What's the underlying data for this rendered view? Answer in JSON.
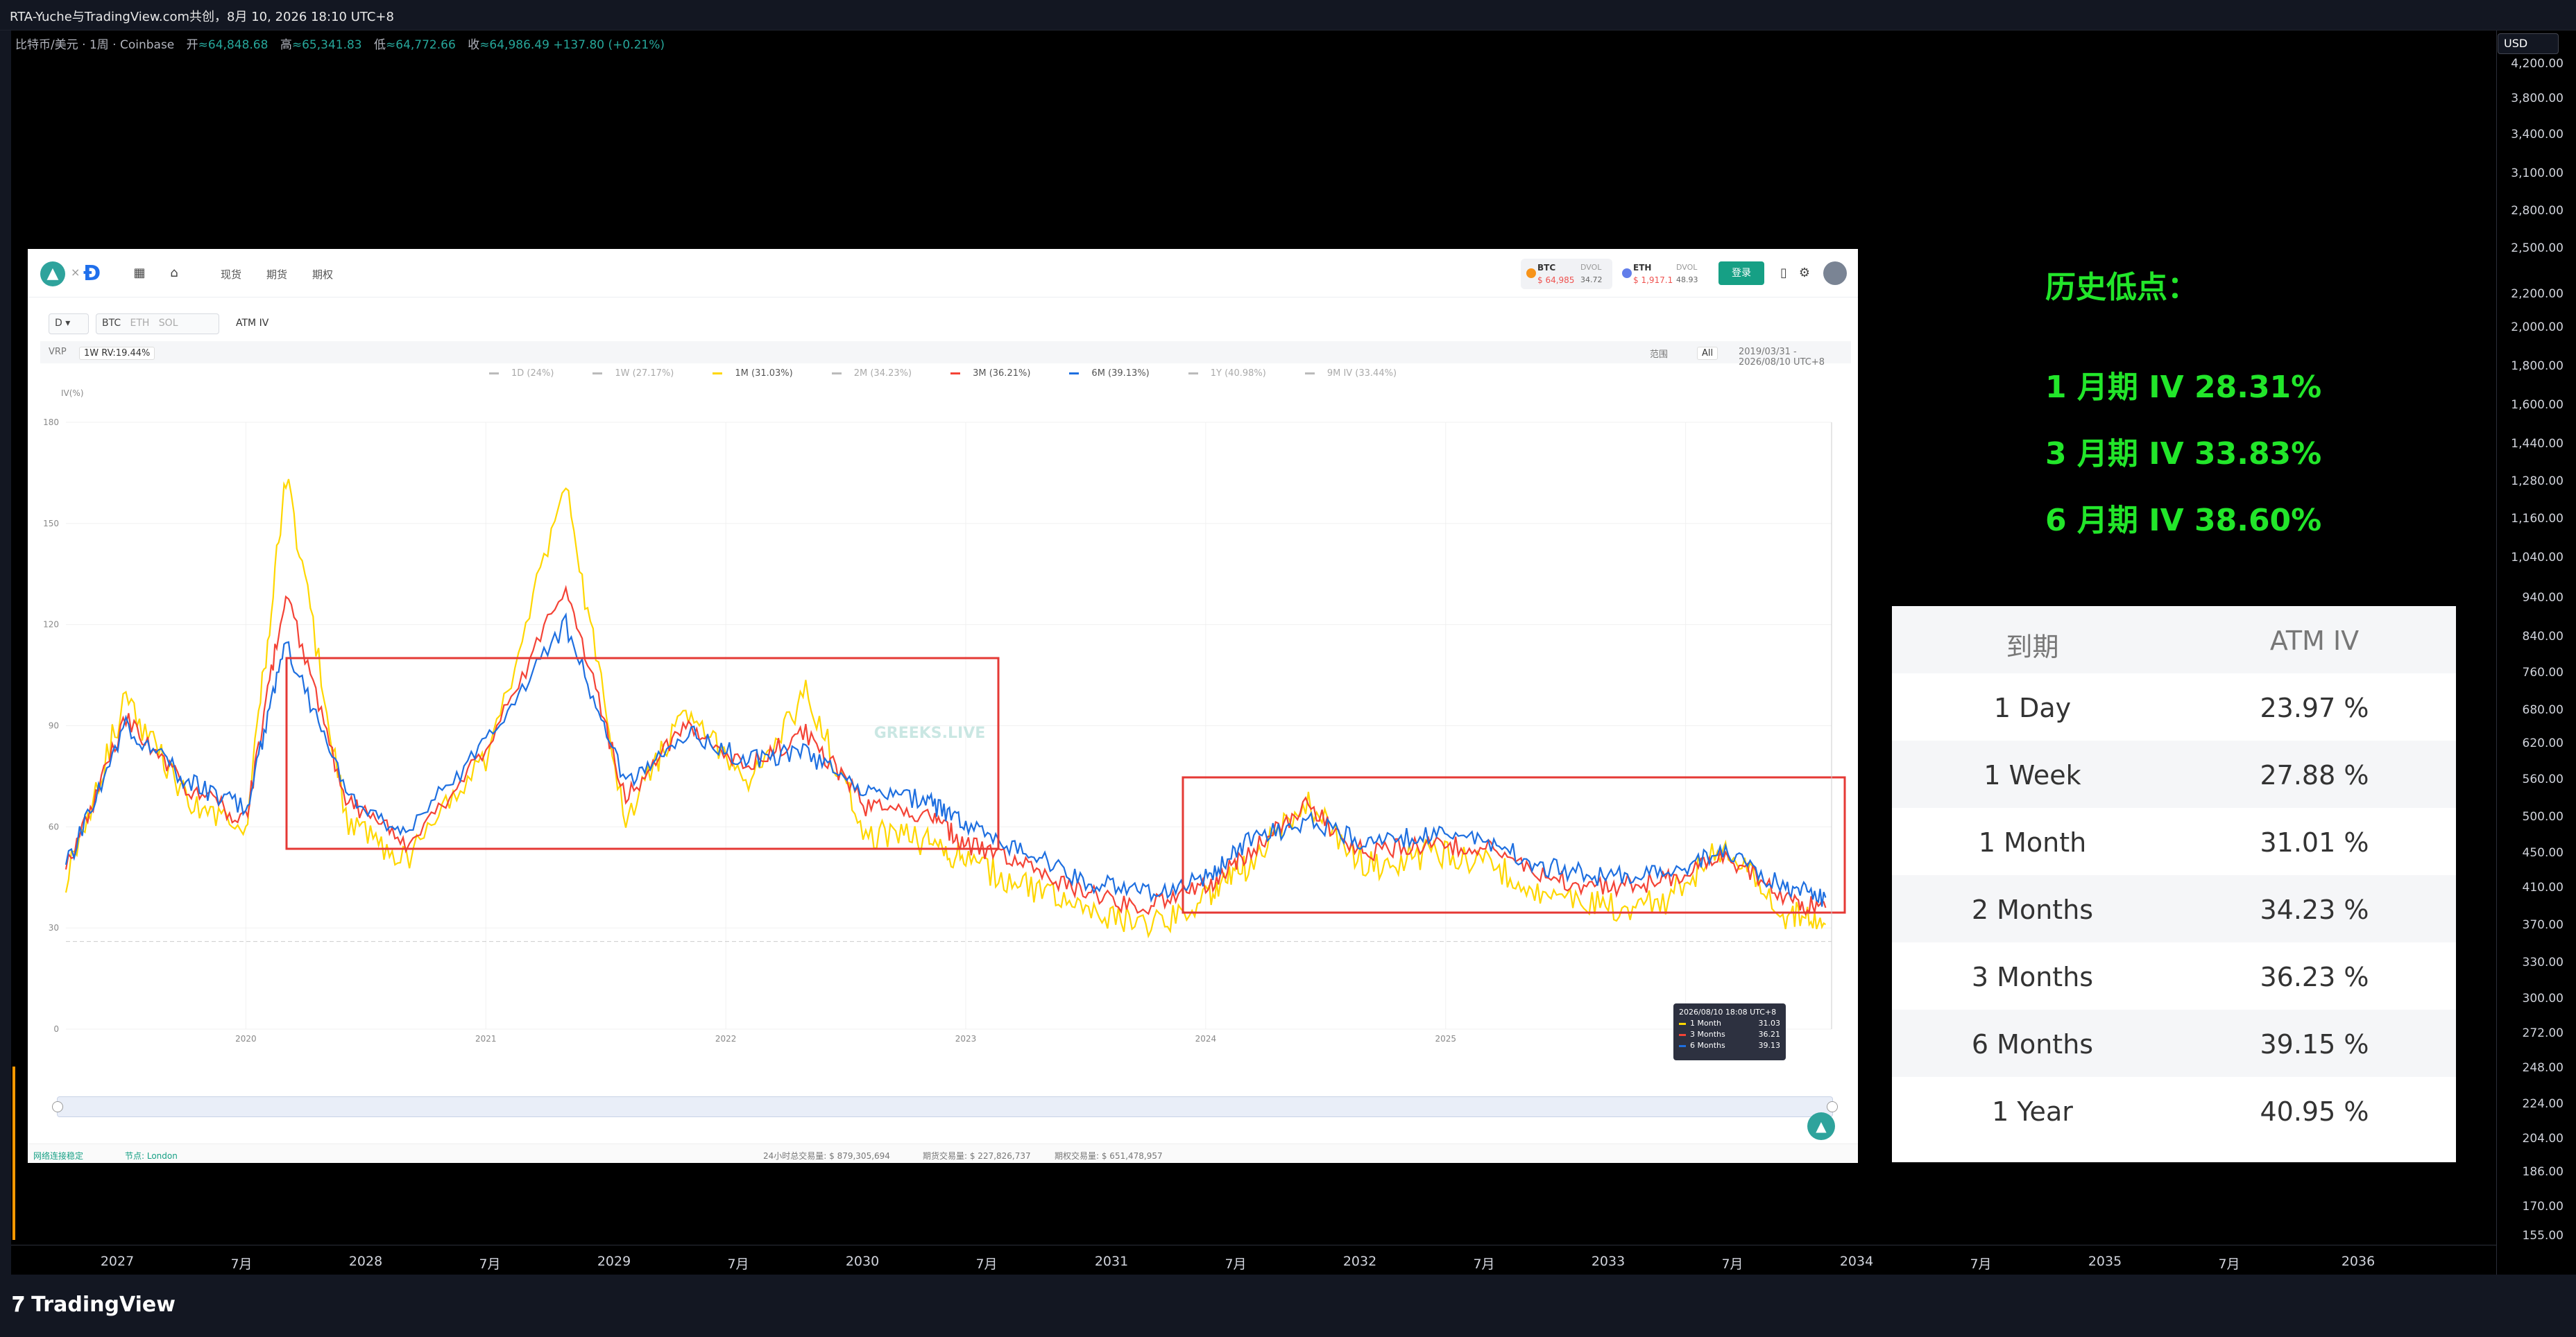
{
  "window": {
    "title": "RTA-Yuche与TradingView.com共创，8月 10, 2026 18:10 UTC+8"
  },
  "symbol_bar": {
    "symbol": "比特币/美元 · 1周 · Coinbase",
    "open_label": "开",
    "open": "≈64,848.68",
    "high_label": "高",
    "high": "≈65,341.83",
    "low_label": "低",
    "low": "≈64,772.66",
    "close_label": "收",
    "close": "≈64,986.49",
    "change": "+137.80 (+0.21%)"
  },
  "price_scale": {
    "currency": "USD",
    "ticks": [
      "4,200.00",
      "3,800.00",
      "3,400.00",
      "3,100.00",
      "2,800.00",
      "2,500.00",
      "2,200.00",
      "2,000.00",
      "1,800.00",
      "1,600.00",
      "1,440.00",
      "1,280.00",
      "1,160.00",
      "1,040.00",
      "940.00",
      "840.00",
      "760.00",
      "680.00",
      "620.00",
      "560.00",
      "500.00",
      "450.00",
      "410.00",
      "370.00",
      "330.00",
      "300.00",
      "272.00",
      "248.00",
      "224.00",
      "204.00",
      "186.00",
      "170.00",
      "155.00"
    ]
  },
  "time_axis": {
    "ticks": [
      "2027",
      "7月",
      "2028",
      "7月",
      "2029",
      "7月",
      "2030",
      "7月",
      "2031",
      "7月",
      "2032",
      "7月",
      "2033",
      "7月",
      "2034",
      "7月",
      "2035",
      "7月",
      "2036"
    ]
  },
  "brand": {
    "name": "TradingView"
  },
  "colors": {
    "annotation": "#22e62a",
    "one_month": "#ffd700",
    "three_months": "#f44336",
    "six_months": "#1e6fe0",
    "box": "#e53935",
    "accent": "#2ea39c"
  },
  "embedded": {
    "nav": {
      "items": [
        "现货",
        "期货",
        "期权"
      ]
    },
    "tickers": {
      "btc": {
        "label": "BTC",
        "price": "$ 64,985",
        "dvol_label": "DVOL",
        "dvol": "34.72"
      },
      "eth": {
        "label": "ETH",
        "price": "$ 1,917.1",
        "dvol_label": "DVOL",
        "dvol": "48.93"
      }
    },
    "login": "登录",
    "controls": {
      "coin_selector": "D",
      "coins": [
        "BTC",
        "ETH",
        "SOL"
      ],
      "metric": "ATM IV",
      "sub_label": "VRP",
      "sub_value": "1W RV:19.44%",
      "period_label": "范围",
      "period": "All",
      "date_range": "2019/03/31 - 2026/08/10 UTC+8"
    },
    "legend": [
      "1D (24%)",
      "1W (27.17%)",
      "1M (31.03%)",
      "2M (34.23%)",
      "3M (36.21%)",
      "6M (39.13%)",
      "1Y (40.98%)",
      "9M IV (33.44%)"
    ],
    "y_unit": "IV(%)",
    "watermark": "GREEKS.LIVE",
    "tooltip": {
      "time": "2026/08/10 18:08 UTC+8",
      "rows": [
        {
          "name": "1 Month",
          "value": "31.03"
        },
        {
          "name": "3 Months",
          "value": "36.21"
        },
        {
          "name": "6 Months",
          "value": "39.13"
        }
      ]
    },
    "footer": {
      "status": "网络连接稳定",
      "region": "节点: London",
      "stat1": "24小时总交易量: $ 879,305,694",
      "stat2": "期货交易量: $ 227,826,737",
      "stat3": "期权交易量: $ 651,478,957"
    }
  },
  "chart_data": {
    "type": "line",
    "ylabel": "IV(%)",
    "ylim": [
      0,
      180
    ],
    "y_ticks": [
      0,
      30,
      60,
      90,
      120,
      150,
      180
    ],
    "x_ticks": [
      "2020",
      "2021",
      "2022",
      "2023",
      "2024",
      "2025",
      "2026"
    ],
    "x": [
      "2019-04",
      "2019-07",
      "2019-10",
      "2020-01",
      "2020-03",
      "2020-06",
      "2020-09",
      "2021-01",
      "2021-05",
      "2021-08",
      "2021-11",
      "2022-02",
      "2022-05",
      "2022-08",
      "2022-11",
      "2023-01",
      "2023-04",
      "2023-07",
      "2023-10",
      "2024-01",
      "2024-03",
      "2024-06",
      "2024-09",
      "2024-12",
      "2025-03",
      "2025-06",
      "2025-09",
      "2025-12",
      "2026-03",
      "2026-06",
      "2026-08"
    ],
    "series": [
      {
        "name": "1 Month",
        "values": [
          45,
          98,
          68,
          58,
          165,
          62,
          50,
          80,
          160,
          62,
          95,
          72,
          100,
          58,
          56,
          50,
          42,
          35,
          30,
          38,
          48,
          68,
          48,
          52,
          50,
          40,
          36,
          38,
          55,
          34,
          31
        ]
      },
      {
        "name": "3 Months",
        "values": [
          47,
          92,
          72,
          62,
          130,
          68,
          55,
          82,
          132,
          68,
          90,
          78,
          88,
          66,
          64,
          55,
          48,
          40,
          36,
          42,
          52,
          66,
          52,
          55,
          54,
          45,
          42,
          44,
          52,
          38,
          36
        ]
      },
      {
        "name": "6 Months",
        "values": [
          48,
          90,
          74,
          65,
          115,
          70,
          58,
          85,
          120,
          72,
          88,
          80,
          82,
          70,
          68,
          60,
          52,
          44,
          40,
          45,
          55,
          62,
          55,
          58,
          56,
          48,
          45,
          47,
          52,
          42,
          39
        ]
      }
    ]
  },
  "annotation": {
    "title": "历史低点：",
    "lines": [
      "1 月期 IV 28.31%",
      "3 月期 IV 33.83%",
      "6 月期 IV 38.60%"
    ]
  },
  "iv_table": {
    "headers": [
      "到期",
      "ATM IV"
    ],
    "rows": [
      {
        "expiry": "1 Day",
        "iv": "23.97 %"
      },
      {
        "expiry": "1 Week",
        "iv": "27.88 %"
      },
      {
        "expiry": "1 Month",
        "iv": "31.01 %"
      },
      {
        "expiry": "2 Months",
        "iv": "34.23 %"
      },
      {
        "expiry": "3 Months",
        "iv": "36.23 %"
      },
      {
        "expiry": "6 Months",
        "iv": "39.15 %"
      },
      {
        "expiry": "1 Year",
        "iv": "40.95 %"
      }
    ]
  }
}
